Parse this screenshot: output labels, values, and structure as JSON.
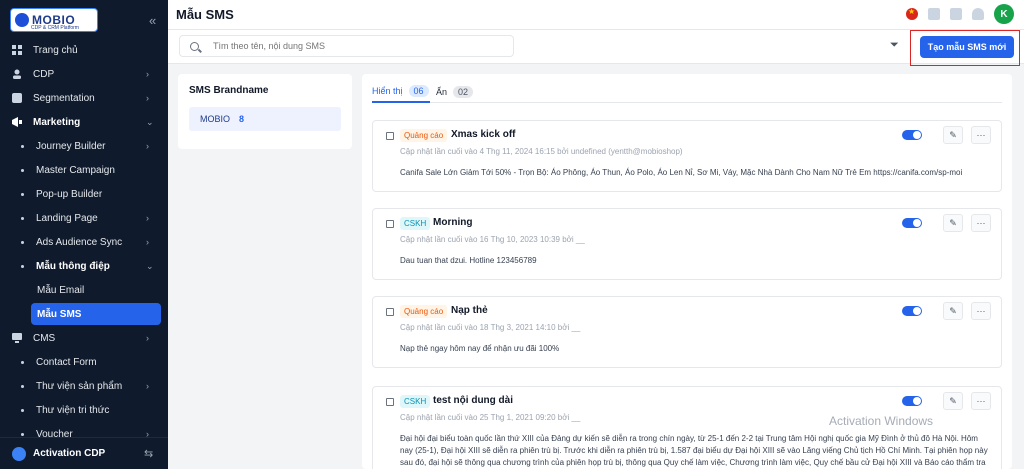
{
  "app": {
    "logo_text": "MOBIO",
    "logo_subtitle": "CDP & CRM Platform",
    "page_title": "Mẫu SMS"
  },
  "sidebar": {
    "items": [
      {
        "label": "Trang chủ",
        "icon": "home-icon",
        "chevron": false
      },
      {
        "label": "CDP",
        "icon": "user-icon",
        "chevron": true
      },
      {
        "label": "Segmentation",
        "icon": "segment-icon",
        "chevron": true
      },
      {
        "label": "Marketing",
        "icon": "megaphone-icon",
        "chevron": true,
        "expanded": true
      },
      {
        "label": "Journey Builder",
        "sub": true,
        "chevron": true
      },
      {
        "label": "Master Campaign",
        "sub": true,
        "chevron": false
      },
      {
        "label": "Pop-up Builder",
        "sub": true,
        "chevron": false
      },
      {
        "label": "Landing Page",
        "sub": true,
        "chevron": true
      },
      {
        "label": "Ads Audience Sync",
        "sub": true,
        "chevron": true
      },
      {
        "label": "Mẫu thông điệp",
        "sub": true,
        "chevron": true,
        "expanded": true
      },
      {
        "label": "Mẫu Email",
        "subsub": true
      },
      {
        "label": "Mẫu SMS",
        "subsub": true,
        "active": true
      },
      {
        "label": "CMS",
        "icon": "monitor-icon",
        "chevron": true
      },
      {
        "label": "Contact Form",
        "sub": true,
        "chevron": false
      },
      {
        "label": "Thư viện sản phẩm",
        "sub": true,
        "chevron": true
      },
      {
        "label": "Thư viện tri thức",
        "sub": true,
        "chevron": false
      },
      {
        "label": "Voucher",
        "sub": true,
        "chevron": true
      }
    ],
    "bottom_label": "Activation CDP"
  },
  "header": {
    "avatar_initial": "K"
  },
  "toolbar": {
    "search_placeholder": "Tìm theo tên, nội dung SMS",
    "create_label": "Tạo mẫu SMS mới"
  },
  "brand_panel": {
    "title": "SMS Brandname",
    "items": [
      {
        "name": "MOBIO",
        "count": "8"
      }
    ]
  },
  "tabs": [
    {
      "label": "Hiển thị",
      "count": "06"
    },
    {
      "label": "Ẩn",
      "count": "02"
    }
  ],
  "templates": [
    {
      "tag": "Quảng cáo",
      "title": "Xmas kick off",
      "meta": "Cập nhật lần cuối vào 4 Thg 11, 2024 16:15 bởi undefined (yentth@mobioshop)",
      "content": "Canifa Sale Lớn Giảm Tới 50% - Trọn Bộ: Áo Phông, Áo Thun, Áo Polo, Áo Len Nỉ, Sơ Mi, Váy, Mặc Nhà Dành Cho Nam Nữ Trẻ Em https://canifa.com/sp-moi"
    },
    {
      "tag": "CSKH",
      "title": "Morning",
      "meta": "Cập nhật lần cuối vào 16 Thg 10, 2023 10:39 bởi __",
      "content": "Dau tuan that dzui. Hotline 123456789"
    },
    {
      "tag": "Quảng cáo",
      "title": "Nạp thẻ",
      "meta": "Cập nhật lần cuối vào 18 Thg 3, 2021 14:10 bởi __",
      "content": "Nạp thẻ ngay hôm nay để nhận ưu đãi 100%"
    },
    {
      "tag": "CSKH",
      "title": "test nội dung dài",
      "meta": "Cập nhật lần cuối vào 25 Thg 1, 2021 09:20 bởi __",
      "content": "Đại hội đại biểu toàn quốc lần thứ XIII của Đảng dự kiến sẽ diễn ra trong chín ngày, từ 25-1 đến 2-2 tại Trung tâm Hội nghị quốc gia Mỹ Đình ở thủ đô Hà Nội. Hôm nay (25-1), Đại hội XIII sẽ diễn ra phiên trù bị. Trước khi diễn ra phiên trù bị, 1.587 đại biểu dự Đại hội XIII sẽ vào Lăng viếng Chủ tịch Hồ Chí Minh. Tại phiên họp này sau đó, đại hội sẽ thông qua chương trình của phiên họp trù bị, thông qua Quy chế làm việc, Chương trình làm việc, Quy chế bầu cử Đại hội XIII và Báo cáo thẩm tra"
    }
  ],
  "watermark": "Activation Windows",
  "colors": {
    "primary": "#2563eb",
    "sidebar_bg": "#0f1b2d",
    "highlight_border": "#dc2626"
  }
}
